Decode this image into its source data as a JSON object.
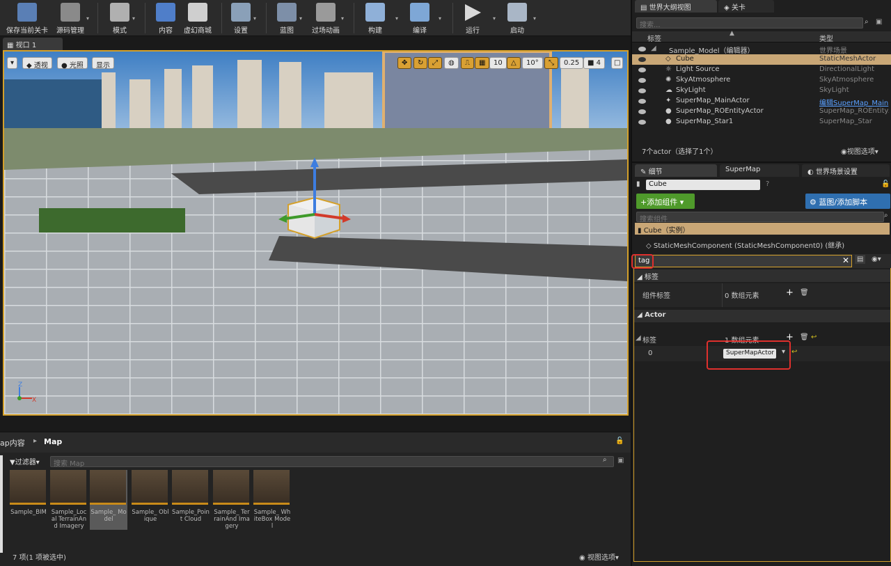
{
  "toolbar": {
    "items": [
      "保存当前关卡",
      "源码管理",
      "模式",
      "内容",
      "虚幻商城",
      "设置",
      "蓝图",
      "过场动画",
      "构建",
      "编译",
      "运行",
      "启动"
    ]
  },
  "viewport": {
    "tab_label": "视口 1",
    "btn_perspective": "透视",
    "btn_lit": "光照",
    "btn_show": "显示",
    "snap_grid": "10",
    "snap_rot": "10°",
    "snap_scale": "0.25",
    "cam_speed": "4",
    "axis_z": "Z",
    "axis_x": "X"
  },
  "content_browser": {
    "breadcrumb_root": "ap内容",
    "breadcrumb_folder": "Map",
    "filter_label": "过滤器",
    "search_placeholder": "搜索 Map",
    "assets": [
      "Sample_BIM",
      "Sample_Local TerrainAnd Imagery",
      "Sample_ Model",
      "Sample_ Oblique",
      "Sample_Point Cloud",
      "Sample_ TerrainAnd Imagery",
      "Sample_ WhiteBox Model"
    ],
    "status": "7 项(1 项被选中)",
    "view_options": "视图选项"
  },
  "outliner": {
    "tab_outliner": "世界大纲视图",
    "tab_levels": "关卡",
    "search_placeholder": "搜索...",
    "col_label": "标签",
    "col_type": "类型",
    "rows": [
      {
        "name": "Sample_Model（编辑器）",
        "type": "世界场景"
      },
      {
        "name": "Cube",
        "type": "StaticMeshActor"
      },
      {
        "name": "Light Source",
        "type": "DirectionalLight"
      },
      {
        "name": "SkyAtmosphere",
        "type": "SkyAtmosphere"
      },
      {
        "name": "SkyLight",
        "type": "SkyLight"
      },
      {
        "name": "SuperMap_MainActor",
        "type": "编辑SuperMap_Main"
      },
      {
        "name": "SuperMap_ROEntityActor",
        "type": "SuperMap_ROEntityAc"
      },
      {
        "name": "SuperMap_Star1",
        "type": "SuperMap_Star"
      }
    ],
    "status": "7个actor（选择了1个）",
    "view_options": "视图选项"
  },
  "details": {
    "tab_details": "细节",
    "tab_supermap": "SuperMap",
    "tab_world": "世界场景设置",
    "actor_name": "Cube",
    "add_component": "+添加组件",
    "blueprint_button": "蓝图/添加脚本",
    "search_component_placeholder": "搜索组件",
    "instance_label": "Cube（实例）",
    "component_label": "StaticMeshComponent (StaticMeshComponent0) (继承)",
    "filter_value": "tag",
    "section_tags": "标签",
    "component_tags_label": "组件标签",
    "component_tags_value": "0 数组元素",
    "section_actor": "Actor",
    "actor_tags_label": "标签",
    "actor_tags_value": "1 数组元素",
    "tag_index": "0",
    "tag_value": "SuperMapActor"
  },
  "colors": {
    "accent": "#d4a02a",
    "highlight": "#e0302d",
    "selection": "#c9a776",
    "blue_btn": "#2f6fb0",
    "green_btn": "#4f9a2b"
  }
}
